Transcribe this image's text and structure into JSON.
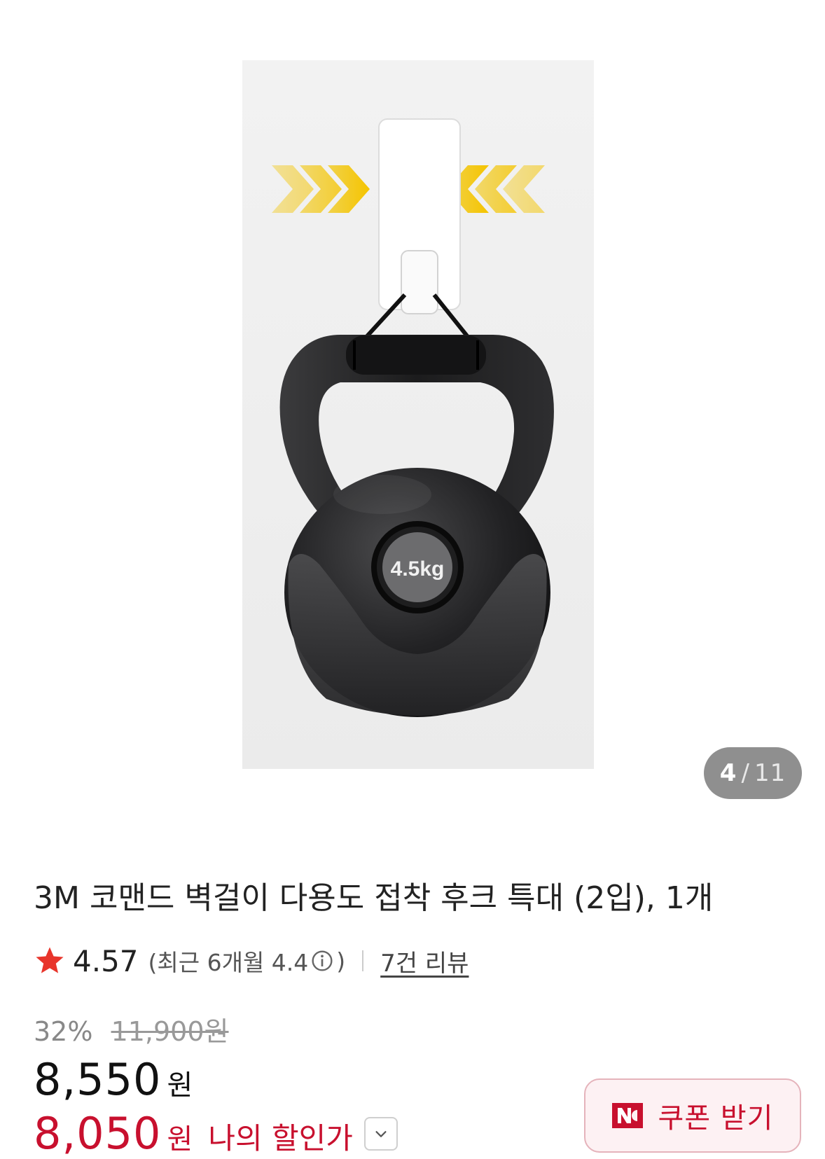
{
  "gallery": {
    "image_label": "4.5kg",
    "page_current": "4",
    "page_separator": "/",
    "page_total": "11"
  },
  "product": {
    "title": "3M 코맨드 벽걸이 다용도 접착 후크 특대 (2입), 1개"
  },
  "rating": {
    "value": "4.57",
    "recent_prefix": "(최근 6개월 4.4",
    "recent_suffix": ")",
    "review_link": "7건 리뷰"
  },
  "price": {
    "discount_rate": "32%",
    "original_price": "11,900원",
    "sale_price": "8,550",
    "sale_unit": "원",
    "my_price": "8,050",
    "my_unit": "원",
    "my_label": "나의 할인가"
  },
  "coupon": {
    "label": "쿠폰 받기"
  },
  "colors": {
    "accent_red": "#c8102e",
    "star_red": "#e8352b",
    "indicator_gray": "#8f8f8f",
    "coupon_bg": "#fdf1f3"
  },
  "icons": {
    "star": "star-icon",
    "info": "info-icon",
    "dropdown": "chevron-down-icon",
    "coupon": "naver-n-coupon-icon",
    "arrows": "chevron-arrows-icon"
  }
}
